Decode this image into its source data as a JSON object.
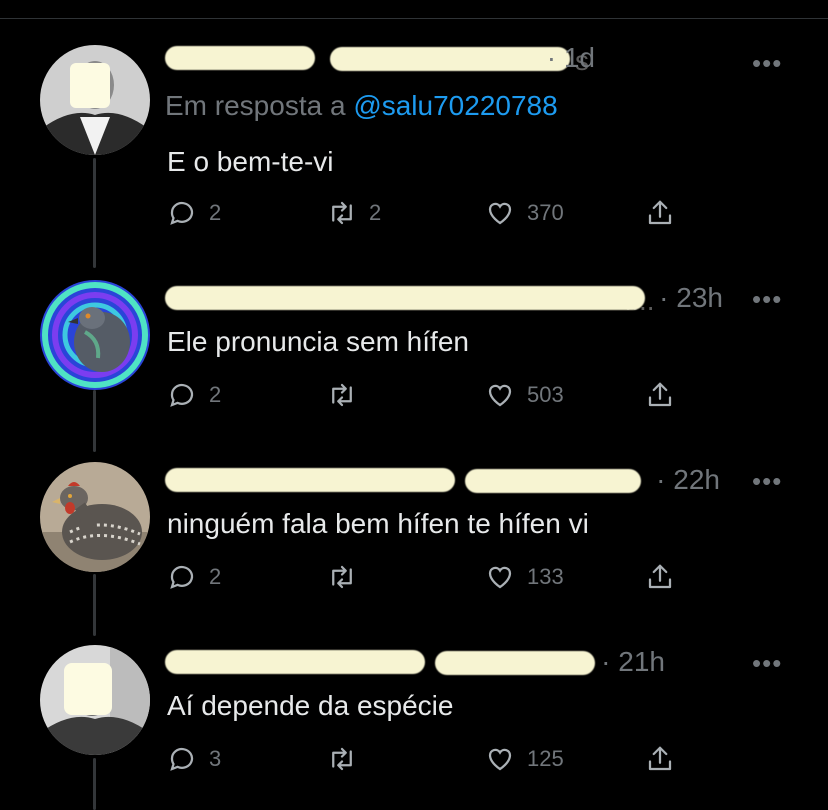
{
  "thread": {
    "tweets": [
      {
        "time": "· 1d",
        "ghost_name": "s",
        "reply_prefix": "Em resposta a ",
        "reply_handle": "@salu70220788",
        "text": "E o bem-te-vi",
        "reply_count": "2",
        "retweet_count": "2",
        "like_count": "370",
        "avatar": "masked-person-avatar"
      },
      {
        "time": "· 23h",
        "ghost_name": "i...",
        "text": "Ele pronuncia sem hífen",
        "reply_count": "2",
        "retweet_count": "",
        "like_count": "503",
        "avatar": "pigeon-psychedelic-avatar"
      },
      {
        "time": "· 22h",
        "ghost_name": "",
        "text": "ninguém fala bem hífen te hífen vi",
        "reply_count": "2",
        "retweet_count": "",
        "like_count": "133",
        "avatar": "hen-avatar"
      },
      {
        "time": "· 21h",
        "ghost_name": "",
        "text": "Aí depende da espécie",
        "reply_count": "3",
        "retweet_count": "",
        "like_count": "125",
        "avatar": "masked-person-avatar"
      }
    ],
    "more_label": "•••"
  },
  "colors": {
    "background": "#000000",
    "text": "#e7e9ea",
    "muted": "#71767b",
    "link": "#1d9bf0",
    "censor": "#f7f4d2"
  }
}
